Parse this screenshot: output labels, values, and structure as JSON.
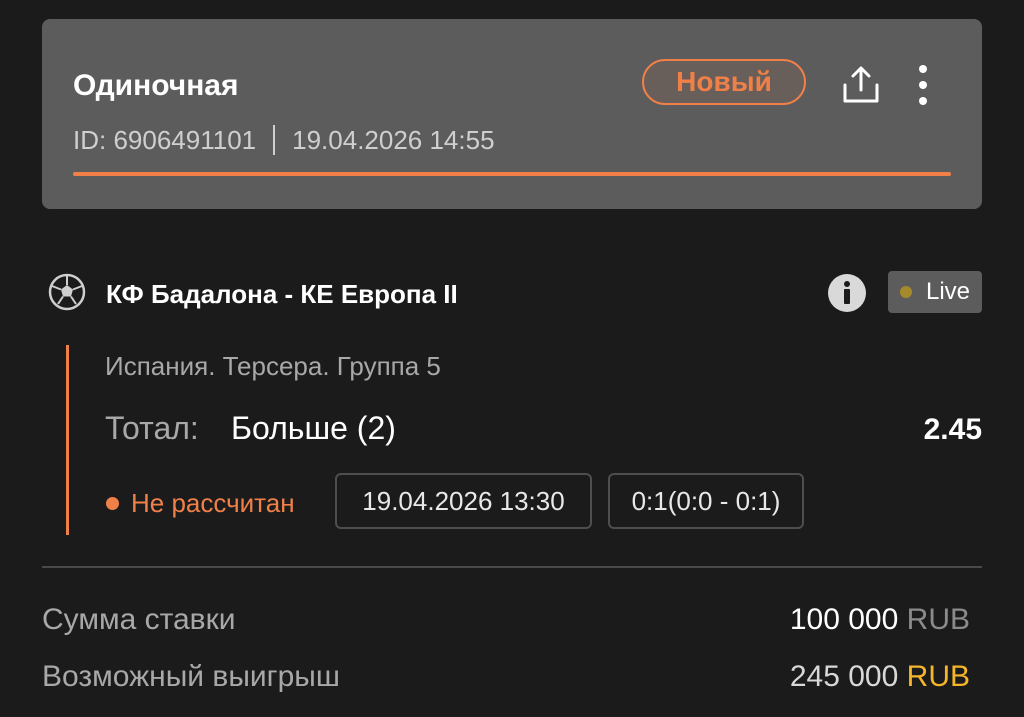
{
  "header": {
    "bet_type": "Одиночная",
    "id_text": "ID: 6906491101",
    "datetime": "19.04.2026 14:55",
    "status": "Новый"
  },
  "event": {
    "title": "КФ Бадалона - КЕ Европа II",
    "live_label": "Live",
    "league": "Испания. Терсера. Группа 5",
    "market_label": "Тотал:",
    "market_value": "Больше (2)",
    "odds": "2.45",
    "settlement_status": "Не рассчитан",
    "start_datetime": "19.04.2026 13:30",
    "score": "0:1(0:0 - 0:1)"
  },
  "summary": {
    "stake_label": "Сумма ставки",
    "stake_amount": "100 000",
    "stake_currency": "RUB",
    "win_label": "Возможный выигрыш",
    "win_amount": "245 000",
    "win_currency": "RUB"
  },
  "icons": {
    "share": "share-icon",
    "more": "more-vertical-icon",
    "sport": "soccer-ball-icon",
    "info": "info-icon"
  },
  "colors": {
    "accent": "#f08048",
    "card_bg": "#5d5c5c",
    "page_bg": "#1c1b1c",
    "gold": "#f5b529",
    "live_dot": "#a58a2c"
  }
}
